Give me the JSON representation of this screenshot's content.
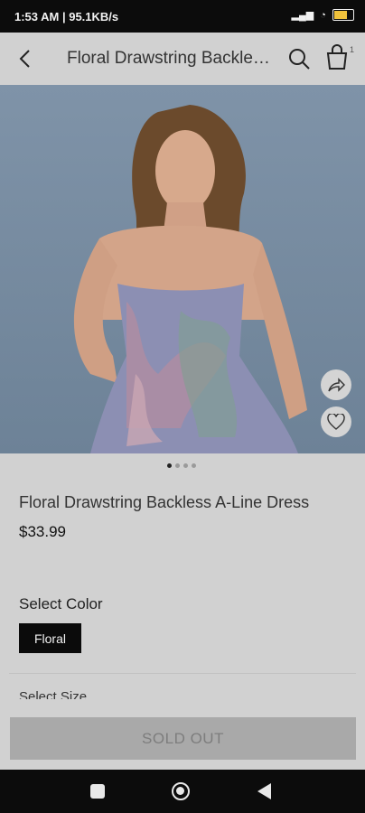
{
  "status_bar": {
    "time": "1:53 AM | 95.1KB/s",
    "icons": [
      "alarm-icon",
      "app-icon",
      "wifi-icon",
      "signal-icon",
      "battery-icon"
    ]
  },
  "header": {
    "title": "Floral Drawstring Backless A-Line Dress",
    "cart_count": "1"
  },
  "gallery": {
    "page_count": 4,
    "active_index": 0
  },
  "product": {
    "name": "Floral Drawstring Backless A-Line Dress",
    "price": "$33.99"
  },
  "color_section": {
    "label": "Select Color",
    "selected": "Floral"
  },
  "size_section": {
    "label": "Select Size"
  },
  "action": {
    "sold_out_label": "SOLD OUT"
  },
  "colors": {
    "accent": "#0b0b0b",
    "background": "#d1d1d1",
    "disabled_button": "#a9a9a9"
  }
}
